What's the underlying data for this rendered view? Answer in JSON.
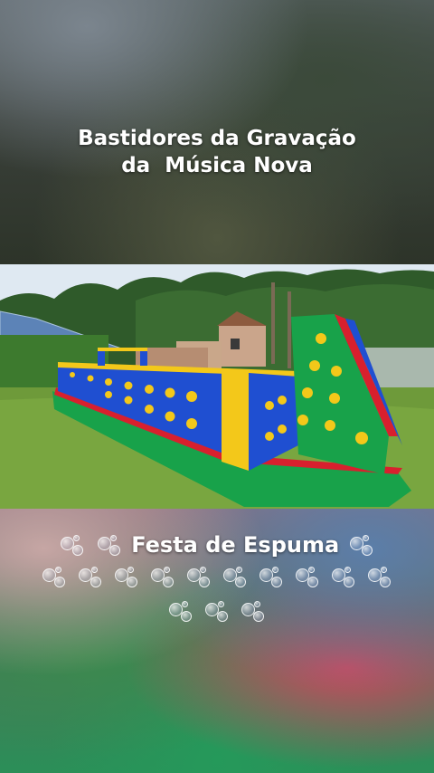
{
  "header": {
    "title_line1": "Bastidores da Gravação",
    "title_line2": "da  Música Nova"
  },
  "photo": {
    "description_icon": "bounce-house-photo"
  },
  "caption": {
    "text": "Festa de Espuma",
    "bubble_icon": "bubbles-icon",
    "row2_bubble_count": 10,
    "row3_bubble_count": 3
  },
  "colors": {
    "title_text": "#ffffff",
    "inflatable_blue": "#1f4fd1",
    "inflatable_yellow": "#f3c81a",
    "inflatable_green": "#18a24a",
    "inflatable_red": "#d8202e"
  }
}
